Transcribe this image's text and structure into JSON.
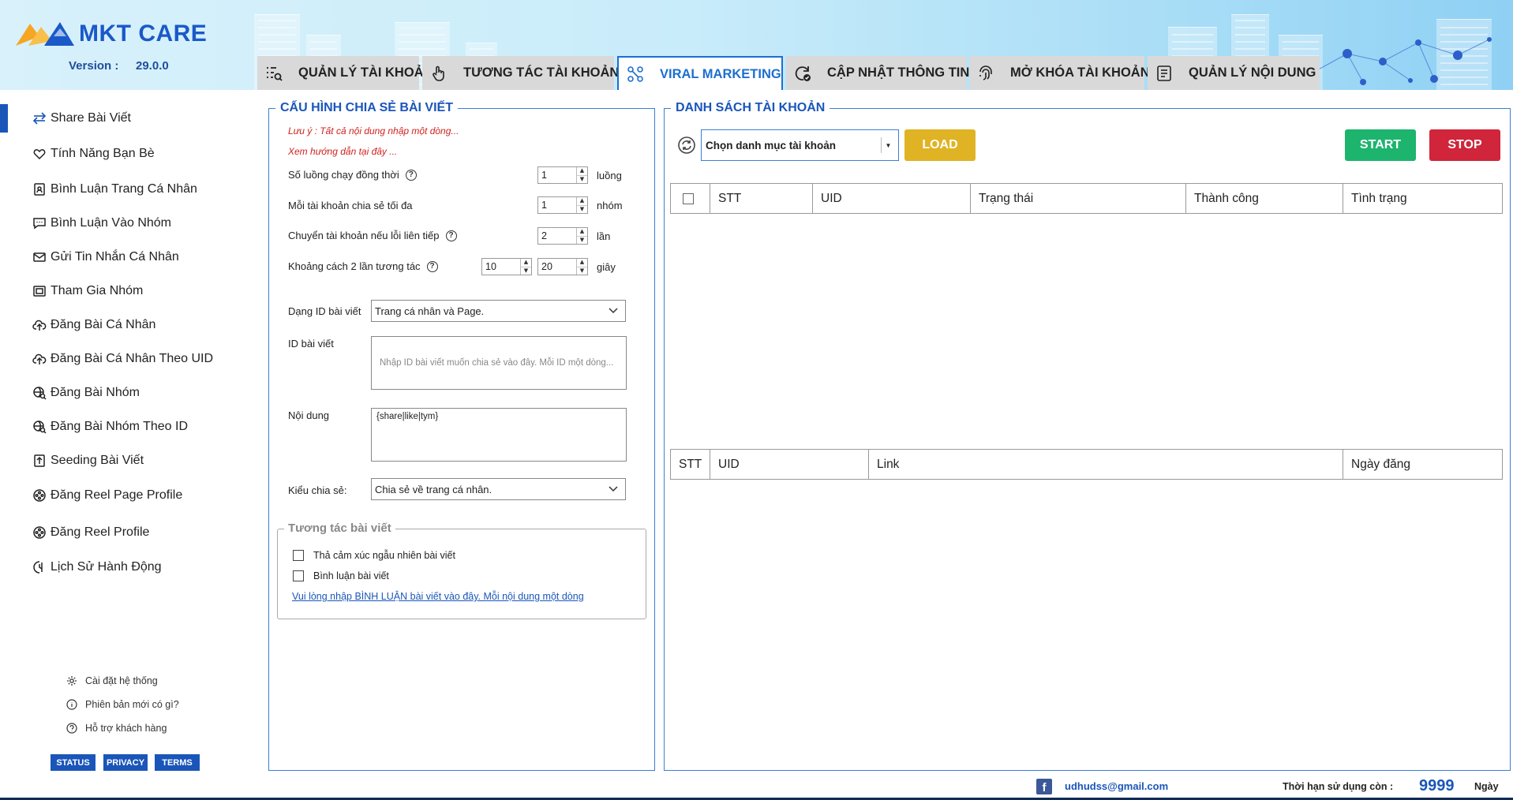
{
  "app": {
    "brand": "MKT CARE",
    "version_label": "Version :",
    "version": "29.0.0",
    "accent_color": "#1a56b9"
  },
  "tabs": [
    {
      "label": "QUẢN LÝ TÀI KHOẢN",
      "icon": "list-search-icon",
      "active": false
    },
    {
      "label": "TƯƠNG TÁC TÀI KHOẢN",
      "icon": "hand-pointer-icon",
      "active": false
    },
    {
      "label": "VIRAL MARKETING",
      "icon": "nodes-icon",
      "active": true
    },
    {
      "label": "CẬP NHẬT THÔNG TIN",
      "icon": "refresh-check-icon",
      "active": false
    },
    {
      "label": "MỞ KHÓA TÀI KHOẢN",
      "icon": "fingerprint-icon",
      "active": false
    },
    {
      "label": "QUẢN LÝ NỘI DUNG",
      "icon": "document-icon",
      "active": false
    }
  ],
  "sidebar": {
    "items": [
      {
        "label": "Share Bài Viết",
        "icon": "share-arrows-icon",
        "active": true
      },
      {
        "label": "Tính Năng Bạn Bè",
        "icon": "hearts-icon"
      },
      {
        "label": "Bình Luận Trang Cá Nhân",
        "icon": "profile-badge-icon"
      },
      {
        "label": "Bình Luận Vào Nhóm",
        "icon": "comment-icon"
      },
      {
        "label": "Gửi Tin Nhắn Cá Nhân",
        "icon": "mail-icon"
      },
      {
        "label": "Tham Gia Nhóm",
        "icon": "group-join-icon"
      },
      {
        "label": "Đăng Bài Cá Nhân",
        "icon": "cloud-upload-icon"
      },
      {
        "label": "Đăng Bài Cá Nhân Theo UID",
        "icon": "cloud-upload-icon"
      },
      {
        "label": "Đăng Bài Nhóm",
        "icon": "globe-search-icon"
      },
      {
        "label": "Đăng Bài Nhóm Theo ID",
        "icon": "globe-search-icon"
      },
      {
        "label": "Seeding Bài Viết",
        "icon": "seed-box-icon"
      },
      {
        "label": "Đăng Reel Page Profile",
        "icon": "reel-icon"
      },
      {
        "label": "Đăng Reel Profile",
        "icon": "reel-icon"
      },
      {
        "label": "Lịch Sử Hành Động",
        "icon": "history-icon"
      }
    ],
    "footer_links": [
      {
        "label": "Cài đặt hệ thống",
        "icon": "gear-icon"
      },
      {
        "label": "Phiên bản mới có gì?",
        "icon": "info-icon"
      },
      {
        "label": "Hỗ trợ khách hàng",
        "icon": "question-icon"
      }
    ],
    "pills": [
      "STATUS",
      "PRIVACY",
      "TERMS"
    ]
  },
  "config": {
    "title": "CẤU HÌNH CHIA SẺ BÀI VIẾT",
    "note1": "Lưu ý : Tất cả nội dung nhập một dòng...",
    "note2": "Xem hướng dẫn tại đây ...",
    "threads_label": "Số luồng chạy đồng thời",
    "threads_value": "1",
    "threads_unit": "luồng",
    "max_share_label": "Mỗi tài khoản chia sẻ tối đa",
    "max_share_value": "1",
    "max_share_unit": "nhóm",
    "switch_label": "Chuyển tài khoản nếu lỗi liên tiếp",
    "switch_value": "2",
    "switch_unit": "lần",
    "interval_label": "Khoảng cách 2 lần tương tác",
    "interval_min": "10",
    "interval_max": "20",
    "interval_unit": "giây",
    "post_id_type_label": "Dạng ID bài viết",
    "post_id_type_value": "Trang cá nhân và Page.",
    "post_id_label": "ID bài viết",
    "post_id_placeholder": "Nhập ID bài viết muốn chia sẻ vào đây. Mỗi ID một dòng...",
    "content_label": "Nội dung",
    "content_value": "{share|like|tym}",
    "share_type_label": "Kiểu chia sẻ:",
    "share_type_value": "Chia sẻ về trang cá nhân.",
    "interaction_title": "Tương tác bài viết",
    "random_reaction_label": "Thả cảm xúc ngẫu nhiên bài viết",
    "comment_label": "Bình luận bài viết",
    "comment_link": "Vui lòng nhập BÌNH LUẬN bài viết vào đây. Mỗi nội dung một dòng"
  },
  "accounts": {
    "title": "DANH SÁCH TÀI KHOẢN",
    "category_placeholder": "Chọn danh mục tài khoản",
    "load_label": "LOAD",
    "start_label": "START",
    "stop_label": "STOP",
    "load_color": "#e0b324",
    "start_color": "#1db46e",
    "stop_color": "#d0253a",
    "columns": [
      "STT",
      "UID",
      "Trạng thái",
      "Thành công",
      "Tình trạng"
    ],
    "log_columns": [
      "STT",
      "UID",
      "Link",
      "Ngày đăng"
    ]
  },
  "footer": {
    "email": "udhudss@gmail.com",
    "expiry_label": "Thời hạn sử dụng còn :",
    "expiry_value": "9999",
    "expiry_unit": "Ngày"
  }
}
